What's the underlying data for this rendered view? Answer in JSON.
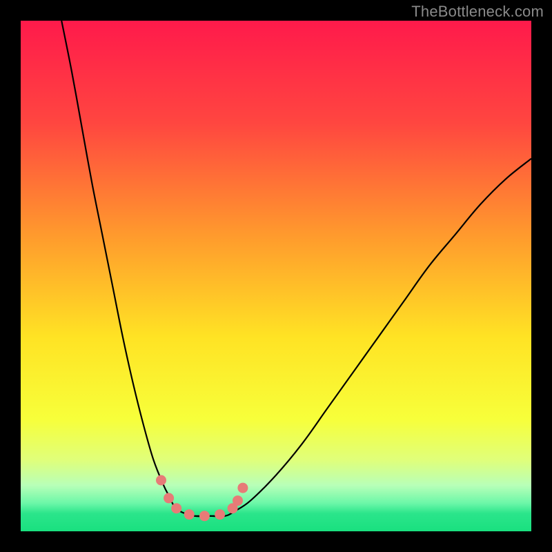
{
  "watermark": {
    "text": "TheBottleneck.com"
  },
  "chart_data": {
    "type": "line",
    "title": "",
    "xlabel": "",
    "ylabel": "",
    "xlim": [
      0,
      100
    ],
    "ylim": [
      0,
      100
    ],
    "grid": false,
    "series": [
      {
        "name": "left-curve",
        "x": [
          8,
          10,
          12,
          14,
          16,
          18,
          20,
          22,
          24,
          26,
          28,
          29,
          30,
          31,
          34,
          37,
          40
        ],
        "y": [
          100,
          90,
          79,
          68,
          58,
          48,
          38,
          29,
          21,
          14,
          9,
          7,
          5,
          4,
          3,
          3,
          3
        ]
      },
      {
        "name": "right-curve",
        "x": [
          34,
          37,
          40,
          42,
          45,
          50,
          55,
          60,
          65,
          70,
          75,
          80,
          85,
          90,
          95,
          100
        ],
        "y": [
          3,
          3,
          3,
          4,
          6,
          11,
          17,
          24,
          31,
          38,
          45,
          52,
          58,
          64,
          69,
          73
        ]
      },
      {
        "name": "marker-dots",
        "x": [
          27.5,
          29.0,
          30.5,
          33.0,
          36.0,
          39.0,
          41.5,
          42.5,
          43.5
        ],
        "y": [
          10.0,
          6.5,
          4.5,
          3.3,
          3.0,
          3.3,
          4.5,
          6.0,
          8.5
        ]
      }
    ],
    "gradient_stops": [
      {
        "offset": 0.0,
        "color": "#ff1a4b"
      },
      {
        "offset": 0.2,
        "color": "#ff4640"
      },
      {
        "offset": 0.42,
        "color": "#ff9a2d"
      },
      {
        "offset": 0.62,
        "color": "#ffe324"
      },
      {
        "offset": 0.78,
        "color": "#f7ff3a"
      },
      {
        "offset": 0.86,
        "color": "#e0ff7a"
      },
      {
        "offset": 0.91,
        "color": "#b8ffb8"
      },
      {
        "offset": 0.945,
        "color": "#6cf7a8"
      },
      {
        "offset": 0.965,
        "color": "#2be58b"
      },
      {
        "offset": 1.0,
        "color": "#19e07f"
      }
    ],
    "marker_color": "#e77b77",
    "curve_color": "#000000"
  }
}
